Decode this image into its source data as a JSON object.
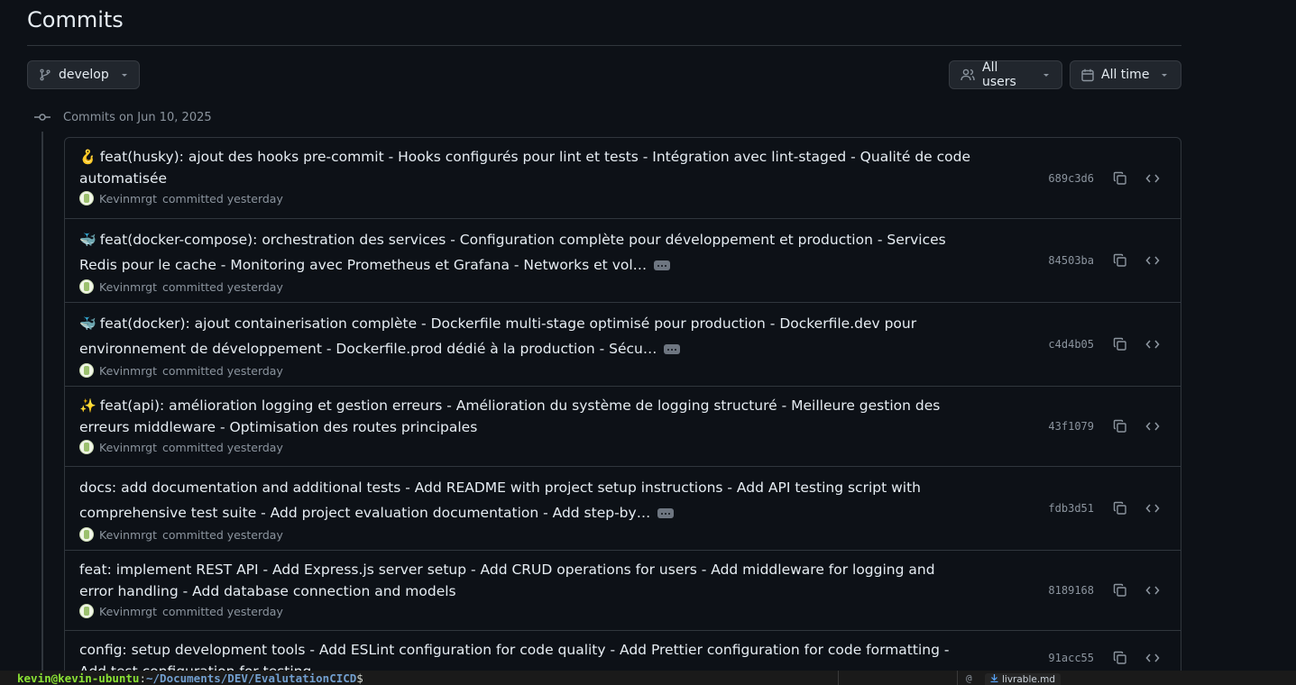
{
  "page": {
    "title": "Commits"
  },
  "filters": {
    "branch": "develop",
    "users": "All users",
    "time": "All time"
  },
  "group": {
    "heading": "Commits on Jun 10, 2025"
  },
  "commits": [
    {
      "emoji": "🪝",
      "message": "feat(husky): ajout des hooks pre-commit - Hooks configurés pour lint et tests - Intégration avec lint-staged - Qualité de code automatisée",
      "author": "Kevinmrgt",
      "when": "committed yesterday",
      "sha": "689c3d6",
      "truncated": false
    },
    {
      "emoji": "🐳",
      "message": "feat(docker-compose): orchestration des services - Configuration complète pour développement et production - Services Redis pour le cache - Monitoring avec Prometheus et Grafana - Networks et vol…",
      "author": "Kevinmrgt",
      "when": "committed yesterday",
      "sha": "84503ba",
      "truncated": true
    },
    {
      "emoji": "🐳",
      "message": "feat(docker): ajout containerisation complète - Dockerfile multi-stage optimisé pour production - Dockerfile.dev pour environnement de développement - Dockerfile.prod dédié à la production - Sécu…",
      "author": "Kevinmrgt",
      "when": "committed yesterday",
      "sha": "c4d4b05",
      "truncated": true
    },
    {
      "emoji": "✨",
      "message": "feat(api): amélioration logging et gestion erreurs - Amélioration du système de logging structuré - Meilleure gestion des erreurs middleware - Optimisation des routes principales",
      "author": "Kevinmrgt",
      "when": "committed yesterday",
      "sha": "43f1079",
      "truncated": false
    },
    {
      "emoji": "",
      "message": "docs: add documentation and additional tests - Add README with project setup instructions - Add API testing script with comprehensive test suite - Add project evaluation documentation - Add step-by…",
      "author": "Kevinmrgt",
      "when": "committed yesterday",
      "sha": "fdb3d51",
      "truncated": true
    },
    {
      "emoji": "",
      "message": "feat: implement REST API - Add Express.js server setup - Add CRUD operations for users - Add middleware for logging and error handling - Add database connection and models",
      "author": "Kevinmrgt",
      "when": "committed yesterday",
      "sha": "8189168",
      "truncated": false
    },
    {
      "emoji": "",
      "message": "config: setup development tools - Add ESLint configuration for code quality - Add Prettier configuration for code formatting - Add test configuration for testing",
      "author": "Kevinmrgt",
      "when": "committed yesterday",
      "sha": "91acc55",
      "truncated": false
    }
  ],
  "terminal": {
    "user": "kevin@kevin-ubuntu",
    "colon": ":",
    "path": "~/Documents/DEV/EvalutationCICD",
    "dollar": "$",
    "tab_file": "livrable.md",
    "at": "@"
  }
}
